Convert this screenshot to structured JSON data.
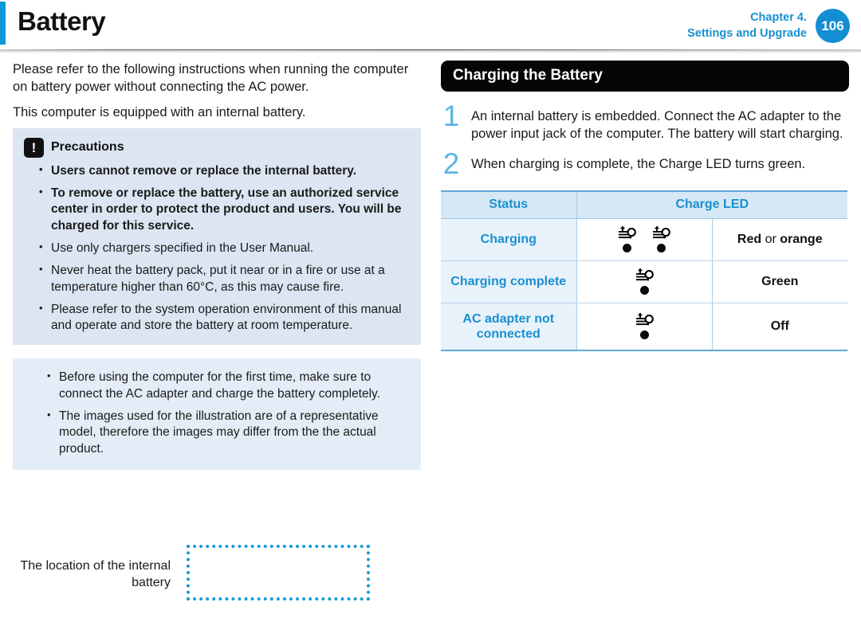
{
  "header": {
    "title": "Battery",
    "chapter_line1": "Chapter 4.",
    "chapter_line2": "Settings and Upgrade",
    "page_number": "106",
    "accent_color": "#0d97d8"
  },
  "left": {
    "intro_1": "Please refer to the following instructions when running the computer on battery power without connecting the AC power.",
    "intro_2": "This computer is equipped with an internal battery.",
    "precautions": {
      "icon": "warning-exclamation-icon",
      "title": "Precautions",
      "items": [
        "Users cannot remove or replace the internal battery.",
        "To remove or replace the battery, use an authorized service center in order to protect the product and users. You will be charged for this service.",
        "Use only chargers specified in the User Manual.",
        "Never heat the battery pack, put it near or in a fire or use at a temperature higher than 60°C, as this may cause fire.",
        "Please refer to the system operation environment of this manual and operate and store the battery at room temperature."
      ]
    },
    "notes": [
      "Before using the computer for the first time, make sure to connect the AC adapter and charge the battery completely.",
      "The images used for the illustration are of a representative model, therefore the images may differ from the the actual product."
    ],
    "illustration": {
      "caption": "The location of the internal battery",
      "placeholder_color": "#1a9ad8"
    }
  },
  "right": {
    "section_title": "Charging the Battery",
    "steps": [
      {
        "number": "1",
        "text": "An internal battery is embedded. Connect the AC adapter to the power input jack of the computer. The battery will start charging."
      },
      {
        "number": "2",
        "text": "When charging is complete, the Charge LED turns green."
      }
    ],
    "table": {
      "headers": [
        "Status",
        "Charge LED"
      ],
      "rows": [
        {
          "status": "Charging",
          "led_icons": 2,
          "icon_name": "charge-led-icon",
          "color_bold_1": "Red",
          "color_middle": " or ",
          "color_bold_2": "orange"
        },
        {
          "status": "Charging complete",
          "led_icons": 1,
          "icon_name": "charge-led-icon",
          "color_bold_1": "Green",
          "color_middle": "",
          "color_bold_2": ""
        },
        {
          "status": "AC adapter not connected",
          "led_icons": 1,
          "icon_name": "charge-led-icon",
          "color_bold_1": "Off",
          "color_middle": "",
          "color_bold_2": ""
        }
      ]
    }
  }
}
